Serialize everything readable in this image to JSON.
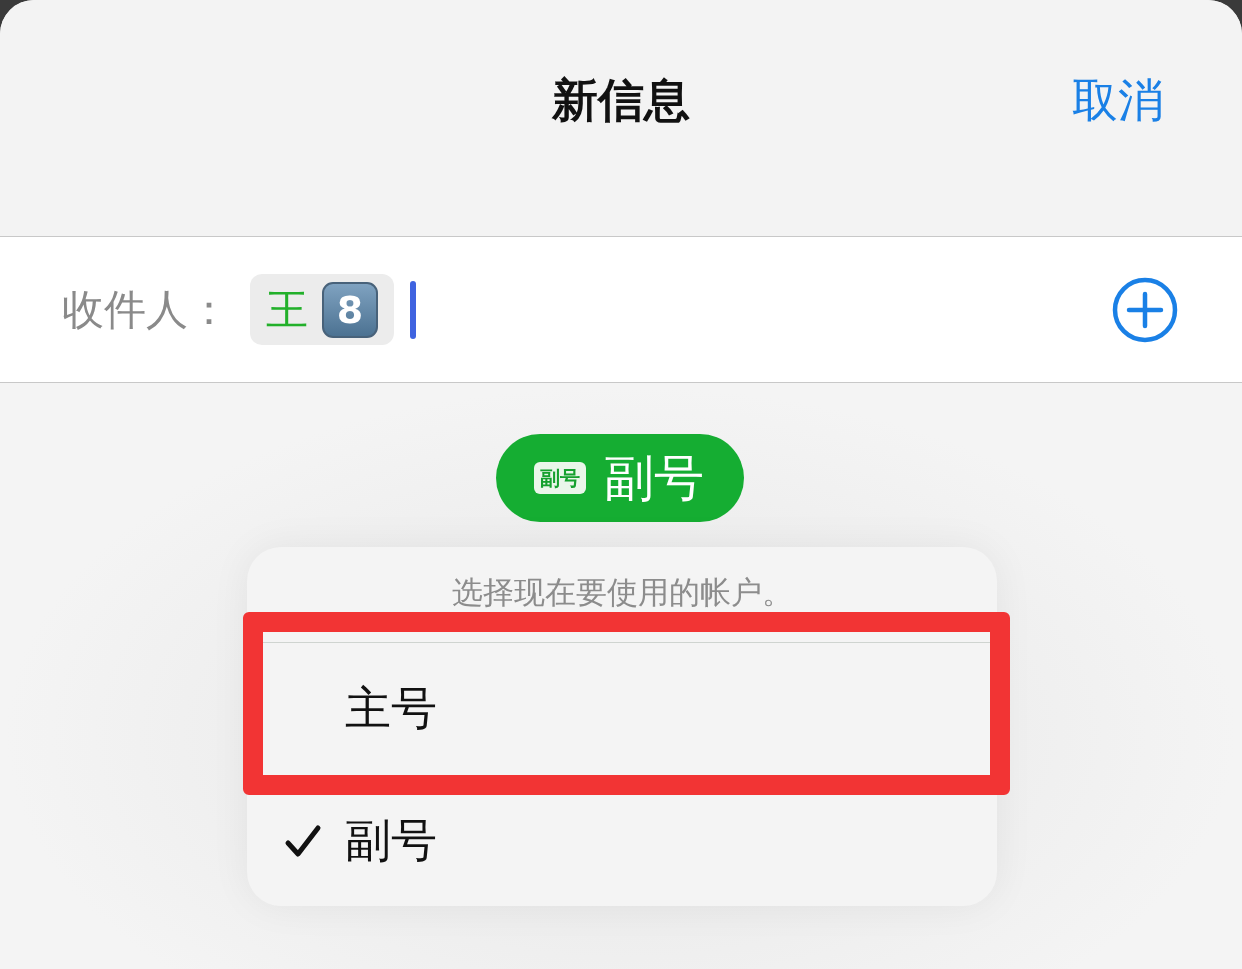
{
  "header": {
    "title": "新信息",
    "cancel": "取消"
  },
  "recipients": {
    "label": "收件人：",
    "chips": [
      {
        "name": "王",
        "keycap": "8"
      }
    ]
  },
  "account_pill": {
    "badge": "副号",
    "label": "副号"
  },
  "account_menu": {
    "prompt": "选择现在要使用的帐户。",
    "items": [
      {
        "label": "主号",
        "selected": false,
        "highlighted": true
      },
      {
        "label": "副号",
        "selected": true,
        "highlighted": false
      }
    ]
  }
}
